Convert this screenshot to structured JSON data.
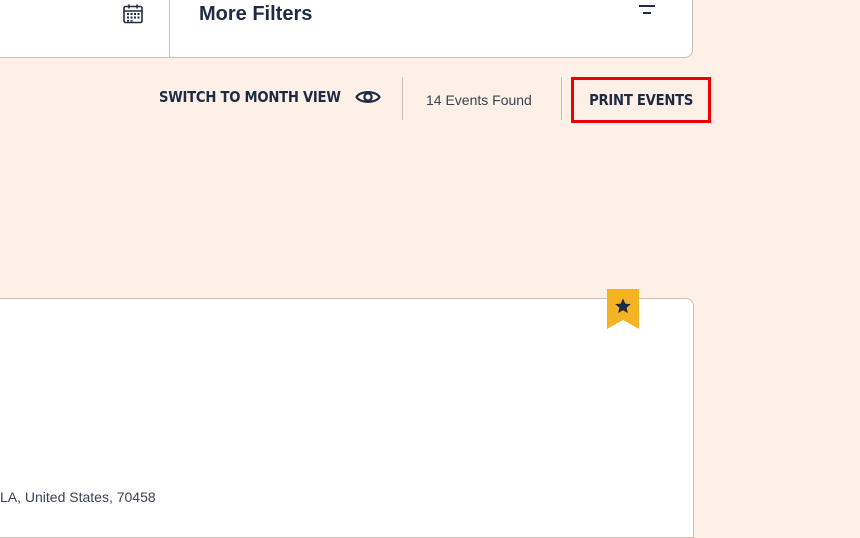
{
  "filters": {
    "calendar_icon": "calendar-icon",
    "more_filters_label": "More Filters",
    "filter_icon": "filter-lines-icon"
  },
  "toolbar": {
    "switch_view_label": "SWITCH TO MONTH VIEW",
    "eye_icon": "eye-icon",
    "events_found": "14 Events Found",
    "print_label": "PRINT EVENTS",
    "print_highlight_color": "#ee0000"
  },
  "event": {
    "address": "LA, United States, 70458",
    "bookmark_icon": "star-bookmark-icon",
    "bookmark_color": "#f5b324"
  },
  "colors": {
    "background": "#fdf1e7",
    "text": "#1f2a44",
    "border": "#cdbfb4"
  }
}
